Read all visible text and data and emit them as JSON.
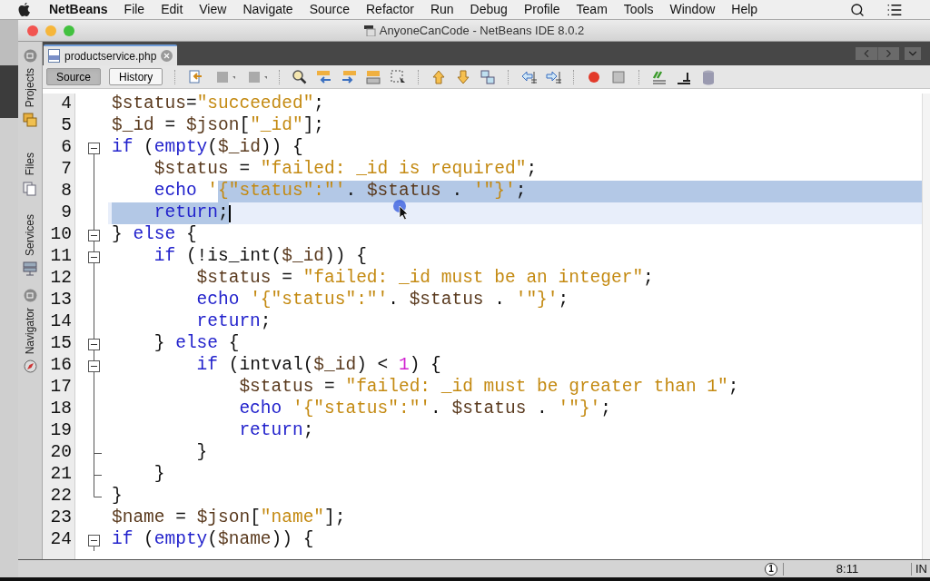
{
  "menu_bar": {
    "app": "NetBeans",
    "items": [
      "File",
      "Edit",
      "View",
      "Navigate",
      "Source",
      "Refactor",
      "Run",
      "Debug",
      "Profile",
      "Team",
      "Tools",
      "Window",
      "Help"
    ]
  },
  "window": {
    "title": "AnyoneCanCode - NetBeans IDE 8.0.2"
  },
  "side_tabs": [
    "Projects",
    "Files",
    "Services",
    "Navigator"
  ],
  "editor_tab": {
    "label": "productservice.php"
  },
  "view_buttons": [
    {
      "label": "Source",
      "selected": true
    },
    {
      "label": "History",
      "selected": false
    }
  ],
  "lines": [
    {
      "number": "4",
      "kind": "plain",
      "current": false,
      "selected_to_end": false,
      "tokens": [
        {
          "text": "$status",
          "kind": "var",
          "selected": false
        },
        {
          "text": "=",
          "kind": "plain",
          "selected": false
        },
        {
          "text": "\"succeeded\"",
          "kind": "str",
          "selected": false
        },
        {
          "text": ";",
          "kind": "plain",
          "selected": false
        }
      ]
    },
    {
      "number": "5",
      "kind": "plain",
      "current": false,
      "selected_to_end": false,
      "tokens": [
        {
          "text": "$_id",
          "kind": "var",
          "selected": false
        },
        {
          "text": " = ",
          "kind": "plain",
          "selected": false
        },
        {
          "text": "$json",
          "kind": "var",
          "selected": false
        },
        {
          "text": "[",
          "kind": "plain",
          "selected": false
        },
        {
          "text": "\"_id\"",
          "kind": "str",
          "selected": false
        },
        {
          "text": "];",
          "kind": "plain",
          "selected": false
        }
      ]
    },
    {
      "number": "6",
      "kind": "fold_start",
      "current": false,
      "selected_to_end": false,
      "tokens": [
        {
          "text": "if",
          "kind": "kw",
          "selected": false
        },
        {
          "text": " (",
          "kind": "plain",
          "selected": false
        },
        {
          "text": "empty",
          "kind": "kw",
          "selected": false
        },
        {
          "text": "(",
          "kind": "plain",
          "selected": false
        },
        {
          "text": "$_id",
          "kind": "var",
          "selected": false
        },
        {
          "text": ")) {",
          "kind": "plain",
          "selected": false
        }
      ]
    },
    {
      "number": "7",
      "kind": "fold_through",
      "current": false,
      "selected_to_end": false,
      "tokens": [
        {
          "text": "    $status",
          "kind": "var",
          "selected": false
        },
        {
          "text": " = ",
          "kind": "plain",
          "selected": false
        },
        {
          "text": "\"failed: _id is required\"",
          "kind": "str",
          "selected": false
        },
        {
          "text": ";",
          "kind": "plain",
          "selected": false
        }
      ]
    },
    {
      "number": "8",
      "kind": "fold_through",
      "current": false,
      "selected_to_end": true,
      "tokens": [
        {
          "text": "    echo ",
          "kind": "kw",
          "selected": false
        },
        {
          "text": "'",
          "kind": "str",
          "selected": false
        },
        {
          "text": "{\"status\":\"'",
          "kind": "str",
          "selected": true
        },
        {
          "text": ". ",
          "kind": "plain",
          "selected": true
        },
        {
          "text": "$status",
          "kind": "var",
          "selected": true
        },
        {
          "text": " . ",
          "kind": "plain",
          "selected": true
        },
        {
          "text": "'\"}'",
          "kind": "str",
          "selected": true
        },
        {
          "text": ";",
          "kind": "plain",
          "selected": true
        }
      ]
    },
    {
      "number": "9",
      "kind": "fold_through",
      "current": true,
      "selected_to_end": false,
      "tokens": [
        {
          "text": "    return",
          "kind": "kw",
          "selected": true
        },
        {
          "text": ";",
          "kind": "plain",
          "selected": true
        }
      ]
    },
    {
      "number": "10",
      "kind": "fold_start",
      "current": false,
      "selected_to_end": false,
      "tokens": [
        {
          "text": "} ",
          "kind": "plain",
          "selected": false
        },
        {
          "text": "else",
          "kind": "kw",
          "selected": false
        },
        {
          "text": " {",
          "kind": "plain",
          "selected": false
        }
      ]
    },
    {
      "number": "11",
      "kind": "fold_start",
      "current": false,
      "selected_to_end": false,
      "tokens": [
        {
          "text": "    if",
          "kind": "kw",
          "selected": false
        },
        {
          "text": " (!is_int(",
          "kind": "plain",
          "selected": false
        },
        {
          "text": "$_id",
          "kind": "var",
          "selected": false
        },
        {
          "text": ")) {",
          "kind": "plain",
          "selected": false
        }
      ]
    },
    {
      "number": "12",
      "kind": "fold_through",
      "current": false,
      "selected_to_end": false,
      "tokens": [
        {
          "text": "        $status",
          "kind": "var",
          "selected": false
        },
        {
          "text": " = ",
          "kind": "plain",
          "selected": false
        },
        {
          "text": "\"failed: _id must be an integer\"",
          "kind": "str",
          "selected": false
        },
        {
          "text": ";",
          "kind": "plain",
          "selected": false
        }
      ]
    },
    {
      "number": "13",
      "kind": "fold_through",
      "current": false,
      "selected_to_end": false,
      "tokens": [
        {
          "text": "        echo ",
          "kind": "kw",
          "selected": false
        },
        {
          "text": "'{\"status\":\"'",
          "kind": "str",
          "selected": false
        },
        {
          "text": ". ",
          "kind": "plain",
          "selected": false
        },
        {
          "text": "$status",
          "kind": "var",
          "selected": false
        },
        {
          "text": " . ",
          "kind": "plain",
          "selected": false
        },
        {
          "text": "'\"}'",
          "kind": "str",
          "selected": false
        },
        {
          "text": ";",
          "kind": "plain",
          "selected": false
        }
      ]
    },
    {
      "number": "14",
      "kind": "fold_through",
      "current": false,
      "selected_to_end": false,
      "tokens": [
        {
          "text": "        return",
          "kind": "kw",
          "selected": false
        },
        {
          "text": ";",
          "kind": "plain",
          "selected": false
        }
      ]
    },
    {
      "number": "15",
      "kind": "fold_start",
      "current": false,
      "selected_to_end": false,
      "tokens": [
        {
          "text": "    } ",
          "kind": "plain",
          "selected": false
        },
        {
          "text": "else",
          "kind": "kw",
          "selected": false
        },
        {
          "text": " {",
          "kind": "plain",
          "selected": false
        }
      ]
    },
    {
      "number": "16",
      "kind": "fold_start",
      "current": false,
      "selected_to_end": false,
      "tokens": [
        {
          "text": "        if",
          "kind": "kw",
          "selected": false
        },
        {
          "text": " (intval(",
          "kind": "plain",
          "selected": false
        },
        {
          "text": "$_id",
          "kind": "var",
          "selected": false
        },
        {
          "text": ") < ",
          "kind": "plain",
          "selected": false
        },
        {
          "text": "1",
          "kind": "num",
          "selected": false
        },
        {
          "text": ") {",
          "kind": "plain",
          "selected": false
        }
      ]
    },
    {
      "number": "17",
      "kind": "fold_through",
      "current": false,
      "selected_to_end": false,
      "tokens": [
        {
          "text": "            $status",
          "kind": "var",
          "selected": false
        },
        {
          "text": " = ",
          "kind": "plain",
          "selected": false
        },
        {
          "text": "\"failed: _id must be greater than 1\"",
          "kind": "str",
          "selected": false
        },
        {
          "text": ";",
          "kind": "plain",
          "selected": false
        }
      ]
    },
    {
      "number": "18",
      "kind": "fold_through",
      "current": false,
      "selected_to_end": false,
      "tokens": [
        {
          "text": "            echo ",
          "kind": "kw",
          "selected": false
        },
        {
          "text": "'{\"status\":\"'",
          "kind": "str",
          "selected": false
        },
        {
          "text": ". ",
          "kind": "plain",
          "selected": false
        },
        {
          "text": "$status",
          "kind": "var",
          "selected": false
        },
        {
          "text": " . ",
          "kind": "plain",
          "selected": false
        },
        {
          "text": "'\"}'",
          "kind": "str",
          "selected": false
        },
        {
          "text": ";",
          "kind": "plain",
          "selected": false
        }
      ]
    },
    {
      "number": "19",
      "kind": "fold_through",
      "current": false,
      "selected_to_end": false,
      "tokens": [
        {
          "text": "            return",
          "kind": "kw",
          "selected": false
        },
        {
          "text": ";",
          "kind": "plain",
          "selected": false
        }
      ]
    },
    {
      "number": "20",
      "kind": "fold_end",
      "current": false,
      "selected_to_end": false,
      "tokens": [
        {
          "text": "        }",
          "kind": "plain",
          "selected": false
        }
      ]
    },
    {
      "number": "21",
      "kind": "fold_end",
      "current": false,
      "selected_to_end": false,
      "tokens": [
        {
          "text": "    }",
          "kind": "plain",
          "selected": false
        }
      ]
    },
    {
      "number": "22",
      "kind": "fold_end_last",
      "current": false,
      "selected_to_end": false,
      "tokens": [
        {
          "text": "}",
          "kind": "plain",
          "selected": false
        }
      ]
    },
    {
      "number": "23",
      "kind": "plain",
      "current": false,
      "selected_to_end": false,
      "tokens": [
        {
          "text": "$name",
          "kind": "var",
          "selected": false
        },
        {
          "text": " = ",
          "kind": "plain",
          "selected": false
        },
        {
          "text": "$json",
          "kind": "var",
          "selected": false
        },
        {
          "text": "[",
          "kind": "plain",
          "selected": false
        },
        {
          "text": "\"name\"",
          "kind": "str",
          "selected": false
        },
        {
          "text": "];",
          "kind": "plain",
          "selected": false
        }
      ]
    },
    {
      "number": "24",
      "kind": "fold_start",
      "current": false,
      "selected_to_end": false,
      "tokens": [
        {
          "text": "if",
          "kind": "kw",
          "selected": false
        },
        {
          "text": " (",
          "kind": "plain",
          "selected": false
        },
        {
          "text": "empty",
          "kind": "kw",
          "selected": false
        },
        {
          "text": "(",
          "kind": "plain",
          "selected": false
        },
        {
          "text": "$name",
          "kind": "var",
          "selected": false
        },
        {
          "text": ")) {",
          "kind": "plain",
          "selected": false
        }
      ]
    }
  ],
  "status_bar": {
    "notifications": "1",
    "position": "8:11",
    "mode": "IN"
  }
}
